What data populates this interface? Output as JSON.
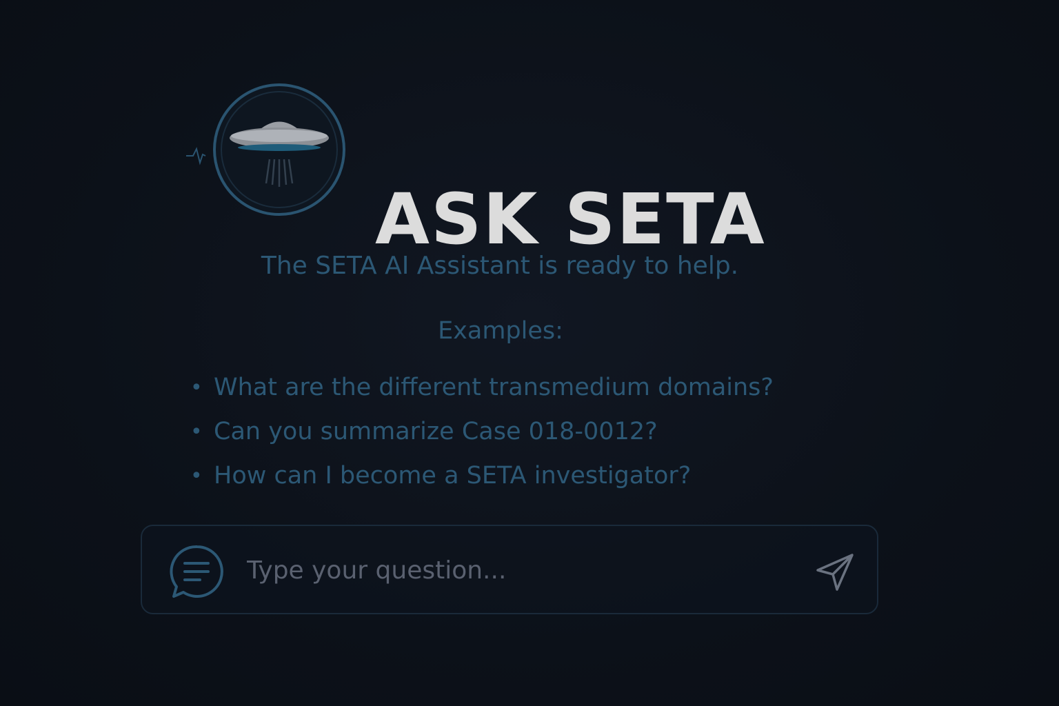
{
  "header": {
    "title": "ASK SETA",
    "logo_icon": "ufo-logo-icon"
  },
  "tagline": "The SETA AI Assistant is ready to help.",
  "examples": {
    "heading": "Examples:",
    "items": [
      "What are the different transmedium domains?",
      "Can you summarize Case 018-0012?",
      "How can I become a SETA investigator?"
    ]
  },
  "input": {
    "placeholder": "Type your question...",
    "chat_icon": "chat-bubble-icon",
    "send_icon": "send-icon"
  },
  "colors": {
    "background": "#0c1119",
    "title": "#dcdcdc",
    "accent": "#2c5875",
    "logo_ring": "#2a5470"
  }
}
